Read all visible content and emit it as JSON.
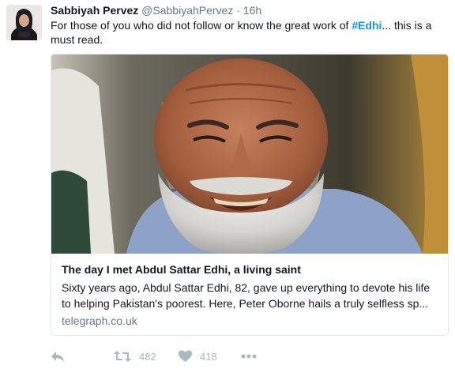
{
  "tweet": {
    "author_name": "Sabbiyah Pervez",
    "author_handle": "@SabbiyahPervez",
    "separator": "·",
    "time": "16h",
    "text_before": "For those of you who did not follow or know the great work of ",
    "hashtag": "#Edhi",
    "text_after": "... this is a must read."
  },
  "card": {
    "title": "The day I met Abdul Sattar Edhi, a living saint",
    "description": "Sixty years ago, Abdul Sattar Edhi, 82, gave up everything to devote his life to helping Pakistan's poorest. Here, Peter Oborne hails a truly selfless sp...",
    "domain": "telegraph.co.uk"
  },
  "actions": {
    "reply_icon": "reply-icon",
    "retweet_icon": "retweet-icon",
    "retweet_count": "482",
    "like_icon": "heart-icon",
    "like_count": "418",
    "more_icon": "more-icon"
  },
  "colors": {
    "hashtag": "#1b95e0",
    "muted": "#657786",
    "icon": "#aab8c2",
    "border": "#e1e8ed"
  }
}
